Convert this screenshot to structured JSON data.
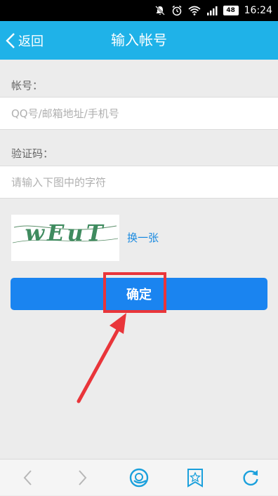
{
  "status": {
    "battery": "48",
    "time": "16:24"
  },
  "header": {
    "back_label": "返回",
    "title": "输入帐号"
  },
  "account": {
    "label": "帐号：",
    "placeholder": "QQ号/邮箱地址/手机号"
  },
  "captcha": {
    "label": "验证码：",
    "placeholder": "请输入下图中的字符",
    "image_text": "wEuT",
    "refresh_label": "换一张"
  },
  "confirm": {
    "label": "确定"
  },
  "colors": {
    "header": "#1fb2e8",
    "button": "#1a84f0",
    "link": "#1a8ae0",
    "annotation": "#e9353a",
    "nav_icon": "#1aa0dc"
  }
}
